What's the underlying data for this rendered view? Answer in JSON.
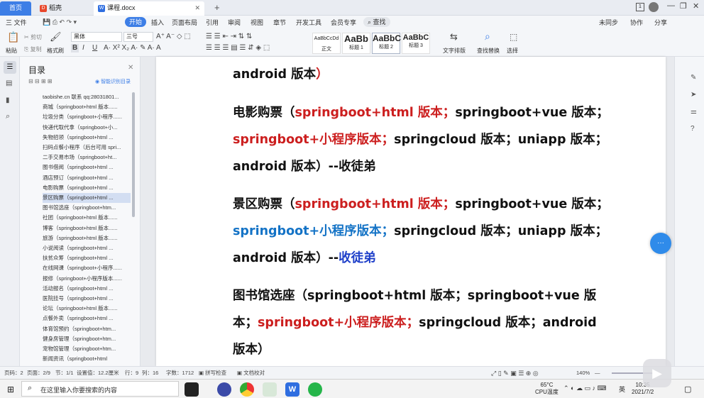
{
  "tabs": [
    {
      "label": "首页",
      "active": true
    },
    {
      "label": "稻壳"
    },
    {
      "label": "课程.docx"
    }
  ],
  "window": {
    "add_tab": "+",
    "badge": "1"
  },
  "menu": [
    "三 文件",
    "开始",
    "插入",
    "页面布局",
    "引用",
    "审阅",
    "视图",
    "章节",
    "开发工具",
    "会员专享"
  ],
  "search_label": "查找",
  "right_menu": [
    "未同步",
    "协作",
    "分享"
  ],
  "ribbon": {
    "paste": "粘贴",
    "cut": "剪切",
    "copy": "复制",
    "format_painter": "格式刷",
    "font": "黑体",
    "size": "三号",
    "text_layout": "文字排版",
    "find_replace": "查找替换",
    "select": "选择"
  },
  "styles": [
    {
      "sample": "AaBbCcDd",
      "name": "正文"
    },
    {
      "sample": "AaBb",
      "name": "标题 1"
    },
    {
      "sample": "AaBbC",
      "name": "标题 2"
    },
    {
      "sample": "AaBbC",
      "name": "标题 3"
    }
  ],
  "toc": {
    "title": "目录",
    "smart": "智能识别目录",
    "items": [
      "taobishe.cn 联系 qq:28031801...",
      "商城（springboot+html 版本......",
      "垃圾分类（springboot+小程序......",
      "快递代取代拿（springboot+小...",
      "失物招领（springboot+html ...",
      "扫码点餐小程序（后台可用 spri...",
      "二手交易市场（springboot+ht...",
      "图书借阅（springboot+html ...",
      "酒店预订（springboot+html ...",
      "电影购票（springboot+html ...",
      "景区购票（springboot+html ...",
      "图书馆选座（springboot+htm...",
      "社团（springboot+html 版本......",
      "博客（springboot+html 版本......",
      "旅游（springboot+html 版本......",
      "小说阅读（springboot+html ...",
      "扶贫众筹（springboot+html ...",
      "在线网课（springboot+小程序......",
      "报修（springboot+小程序版本......",
      "活动报名（springboot+html ...",
      "医院挂号（springboot+html ...",
      "论坛（springboot+html 版本......",
      "点餐外卖（springboot+html ...",
      "体育馆预约（springboot+htm...",
      "健身房管理（springboot+htm...",
      "宠物馆管理（springboot+htm...",
      "新闻资讯（springboot+html"
    ],
    "active_index": 10
  },
  "doc": {
    "p0": [
      "android 版本",
      "）"
    ],
    "p1": {
      "a": "电影购票（",
      "b": "springboot+html 版本；",
      "c": "springboot+vue 版本；",
      "d": "springboot+小程序版本；",
      "e": "springcloud 版本；uniapp 版本；",
      "f": "android 版本）--收徒弟"
    },
    "p2": {
      "a": "景区购票（",
      "b": "springboot+html 版本；",
      "c": "springboot+vue 版本；",
      "d": "springboot+小程序版本；",
      "e": "springcloud 版本；uniapp 版本；",
      "f": "android 版本）--",
      "g": "收徒弟"
    },
    "p3": {
      "a": "图书馆选座（springboot+html 版本；springboot+vue 版",
      "b": "本；",
      "c": "springboot+小程序版本；",
      "d": "springcloud 版本；android",
      "e": "版本）"
    }
  },
  "status": {
    "page": "页码：2",
    "pages": "页面：2/9",
    "section": "节：1/1",
    "pos": "设置值：12.2厘米",
    "row": "行：9",
    "col": "列：16",
    "words": "字数：1712",
    "spell": "拼写检查",
    "proof": "文档校对",
    "zoom": "140%"
  },
  "taskbar": {
    "search_placeholder": "在这里输入你要搜索的内容",
    "temp": "65°C",
    "cpu": "CPU温度",
    "time": "10:35",
    "date": "2021/7/2",
    "lang": "英"
  },
  "colors": {
    "red": "#cc1f1f",
    "blue": "#1473c6",
    "accent": "#1a73e8"
  }
}
